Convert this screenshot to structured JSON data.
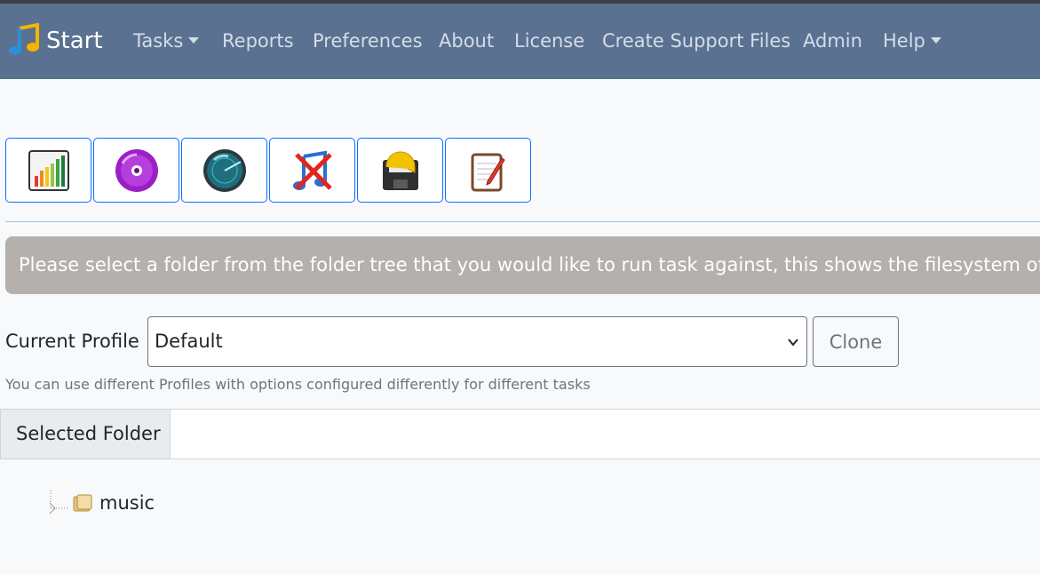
{
  "navbar": {
    "brand": "Start",
    "items": [
      {
        "label": "Tasks",
        "dropdown": true
      },
      {
        "label": "Reports",
        "dropdown": false
      },
      {
        "label": "Preferences",
        "dropdown": false
      },
      {
        "label": "About",
        "dropdown": false
      },
      {
        "label": "License",
        "dropdown": false
      },
      {
        "label": "Create Support Files",
        "dropdown": false
      },
      {
        "label": "Admin",
        "dropdown": false
      },
      {
        "label": "Help",
        "dropdown": true
      }
    ]
  },
  "toolbar": {
    "buttons": [
      {
        "icon": "bar-chart-icon"
      },
      {
        "icon": "purple-disc-icon"
      },
      {
        "icon": "radar-icon"
      },
      {
        "icon": "remove-music-icon"
      },
      {
        "icon": "undo-save-icon"
      },
      {
        "icon": "notepad-edit-icon"
      }
    ]
  },
  "alert": {
    "text": "Please select a folder from the folder tree that you would like to run task against, this shows the filesystem of the re"
  },
  "profile": {
    "label": "Current Profile",
    "selected": "Default",
    "clone_label": "Clone",
    "help": "You can use different Profiles with options configured differently for different tasks"
  },
  "folder": {
    "label": "Selected Folder",
    "value": ""
  },
  "tree": {
    "nodes": [
      {
        "label": "music",
        "icon": "folder-icon"
      }
    ]
  },
  "colors": {
    "navbar": "#5a7191",
    "alert": "#b4b0ae",
    "button_border": "#0d6efd"
  }
}
